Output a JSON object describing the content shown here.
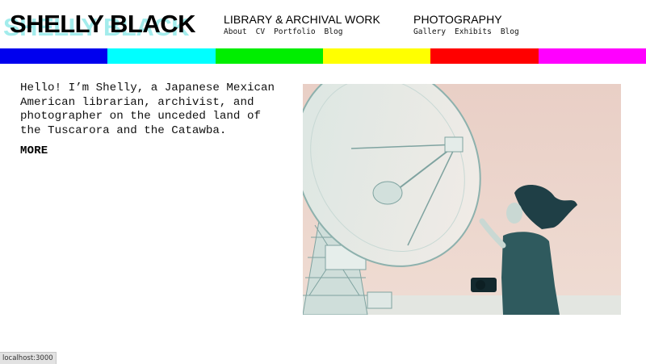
{
  "site": {
    "title": "SHELLY BLACK"
  },
  "nav": {
    "library": {
      "heading": "LIBRARY & ARCHIVAL WORK",
      "links": [
        "About",
        "CV",
        "Portfolio",
        "Blog"
      ]
    },
    "photography": {
      "heading": "PHOTOGRAPHY",
      "links": [
        "Gallery",
        "Exhibits",
        "Blog"
      ]
    }
  },
  "stripes": {
    "colors": [
      "#0000ee",
      "#00ffff",
      "#00ee00",
      "#ffff00",
      "#ff0000",
      "#ff00ff"
    ]
  },
  "intro": {
    "text": "Hello! I’m Shelly, a Japanese Mexican American librarian, archivist, and photographer on the unceded land of the Tuscarora and the Catawba.",
    "more_label": "MORE"
  },
  "status_bar": {
    "url": "localhost:3000"
  }
}
